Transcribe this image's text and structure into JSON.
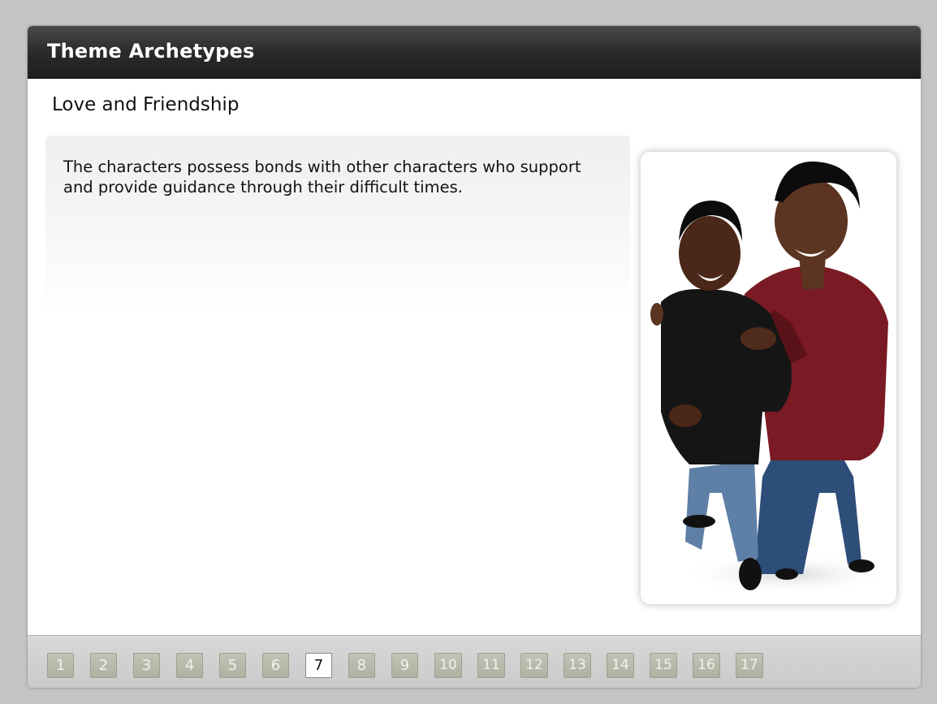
{
  "header": {
    "title": "Theme Archetypes"
  },
  "slide": {
    "heading": "Love and Friendship",
    "body": "The characters possess bonds with other characters who support and provide guidance through their difficult times."
  },
  "image": {
    "description_icon": "two-friends-photo"
  },
  "navigation": {
    "current_page": 7,
    "pages": [
      "1",
      "2",
      "3",
      "4",
      "5",
      "6",
      "7",
      "8",
      "9",
      "10",
      "11",
      "12",
      "13",
      "14",
      "15",
      "16",
      "17"
    ]
  },
  "colors": {
    "titlebar": "#2b2b2b",
    "page_button": "#b5b9a9",
    "page_button_active": "#ffffff",
    "background": "#c4c4c4"
  }
}
